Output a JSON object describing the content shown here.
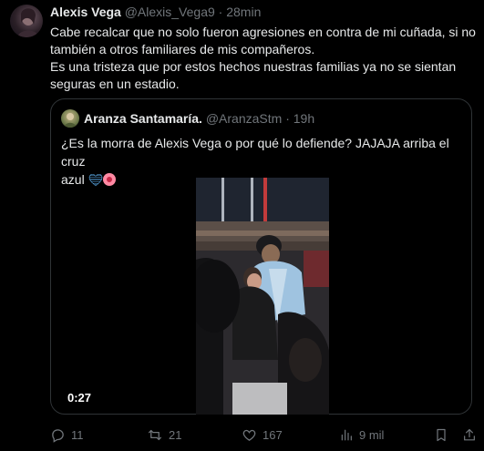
{
  "tweet": {
    "author_name": "Alexis Vega",
    "author_handle": "@Alexis_Vega9",
    "separator": "·",
    "time": "28min",
    "text_lines": [
      "Cabe recalcar que no solo fueron agresiones en contra de mi cuñada, si no",
      "también a otros familiares de mis compañeros.",
      "Es una tristeza que por estos hechos nuestras familias ya no se sientan",
      "seguras en un estadio."
    ]
  },
  "quoted": {
    "author_name": "Aranza Santamaría.",
    "author_handle": "@AranzaStm",
    "separator": "·",
    "time": "19h",
    "text_line1": "¿Es la morra de Alexis Vega o por qué lo defiende? JAJAJA arriba el cruz",
    "text_line2": "azul",
    "video_duration": "0:27"
  },
  "actions": {
    "replies": "11",
    "retweets": "21",
    "likes": "167",
    "views": "9 mil"
  },
  "icons": {
    "reply": "reply-icon",
    "retweet": "retweet-icon",
    "like": "heart-icon",
    "views": "views-icon",
    "bookmark": "bookmark-icon",
    "share": "share-icon"
  },
  "colors": {
    "background": "#000000",
    "text": "#e7e9ea",
    "muted": "#71767b",
    "border": "#2f3336",
    "blue_heart": "#5aa9e6"
  }
}
